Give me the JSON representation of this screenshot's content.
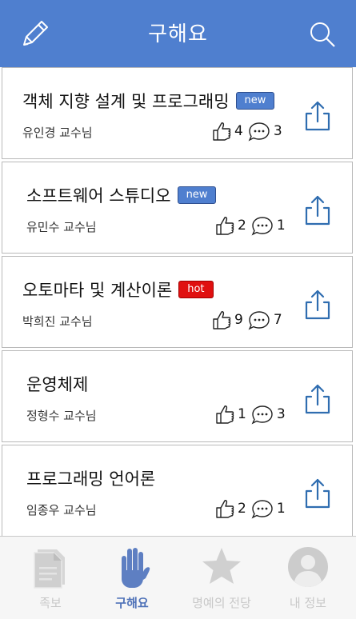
{
  "header": {
    "title": "구해요",
    "left_icon": "pencil-icon",
    "right_icon": "search-icon",
    "color": "#4f7fcf"
  },
  "posts": [
    {
      "title": "객체 지향 설계 및 프로그래밍",
      "badge": "new",
      "professor": "유인경 교수님",
      "likes": "4",
      "comments": "3"
    },
    {
      "title": "소프트웨어 스튜디오",
      "badge": "new",
      "professor": "유민수 교수님",
      "likes": "2",
      "comments": "1"
    },
    {
      "title": "오토마타 및 계산이론",
      "badge": "hot",
      "professor": "박희진 교수님",
      "likes": "9",
      "comments": "7"
    },
    {
      "title": "운영체제",
      "badge": "",
      "professor": "정형수 교수님",
      "likes": "1",
      "comments": "3"
    },
    {
      "title": "프로그래밍 언어론",
      "badge": "",
      "professor": "임종우 교수님",
      "likes": "2",
      "comments": "1"
    }
  ],
  "tabs": [
    {
      "label": "족보",
      "icon": "document-icon",
      "active": false
    },
    {
      "label": "구해요",
      "icon": "raised-hand-icon",
      "active": true
    },
    {
      "label": "명예의 전당",
      "icon": "star-icon",
      "active": false
    },
    {
      "label": "내 정보",
      "icon": "profile-icon",
      "active": false
    }
  ],
  "colors": {
    "new_badge": "#4f7fcf",
    "hot_badge": "#e01010",
    "active_tab": "#4f72b8",
    "inactive_tab": "#c8c8c8"
  }
}
